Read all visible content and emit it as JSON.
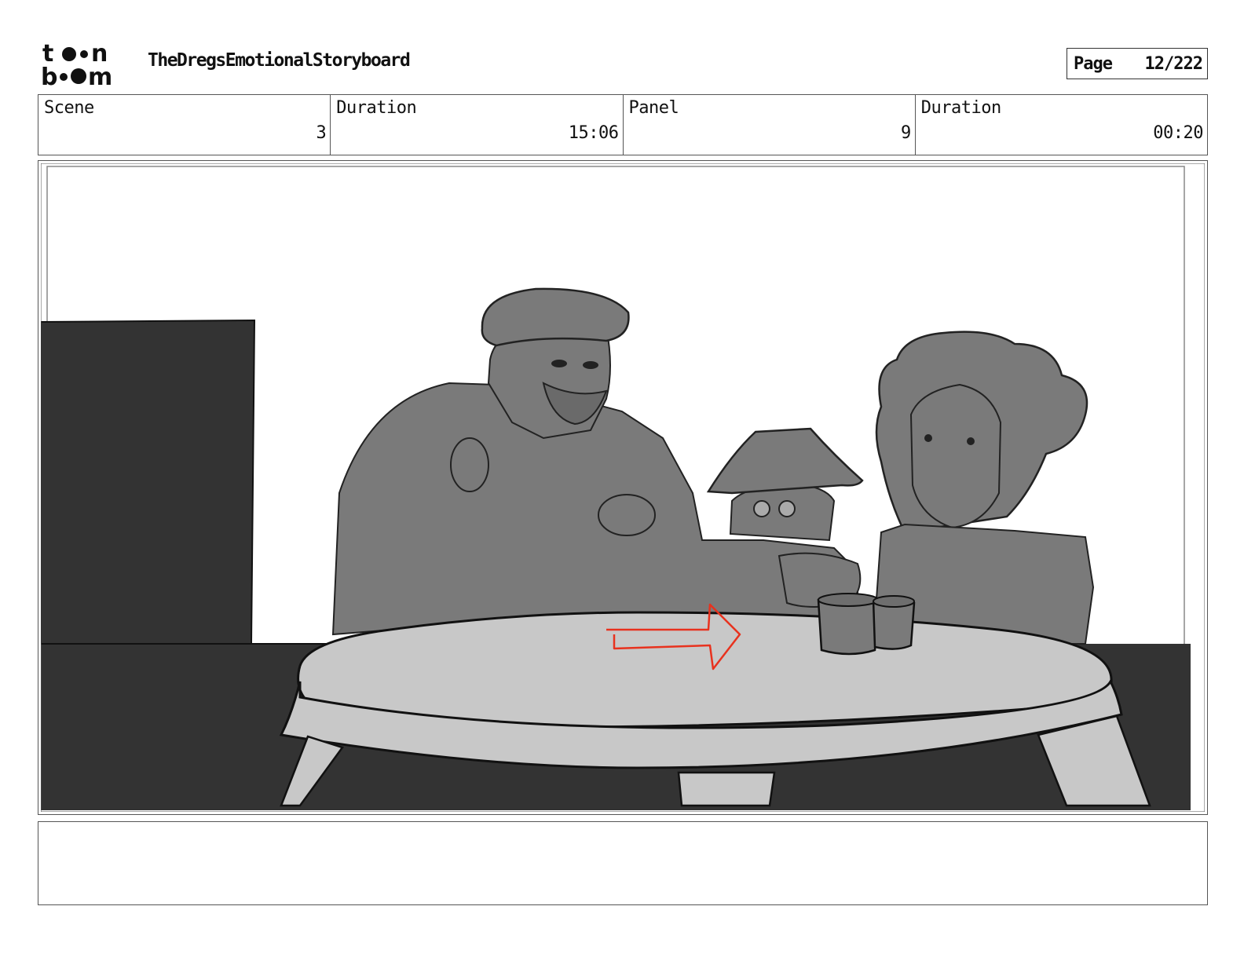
{
  "header": {
    "logo_line1": "toon",
    "logo_line2": "boom",
    "title": "TheDregsEmotionalStoryboard",
    "page_label": "Page",
    "page_value": "12/222"
  },
  "info": {
    "scene_label": "Scene",
    "scene_value": "3",
    "scene_duration_label": "Duration",
    "scene_duration_value": "15:06",
    "panel_label": "Panel",
    "panel_value": "9",
    "panel_duration_label": "Duration",
    "panel_duration_value": "00:20"
  },
  "panel": {
    "arrow_color": "#e8321e"
  },
  "notes": {
    "text": ""
  }
}
